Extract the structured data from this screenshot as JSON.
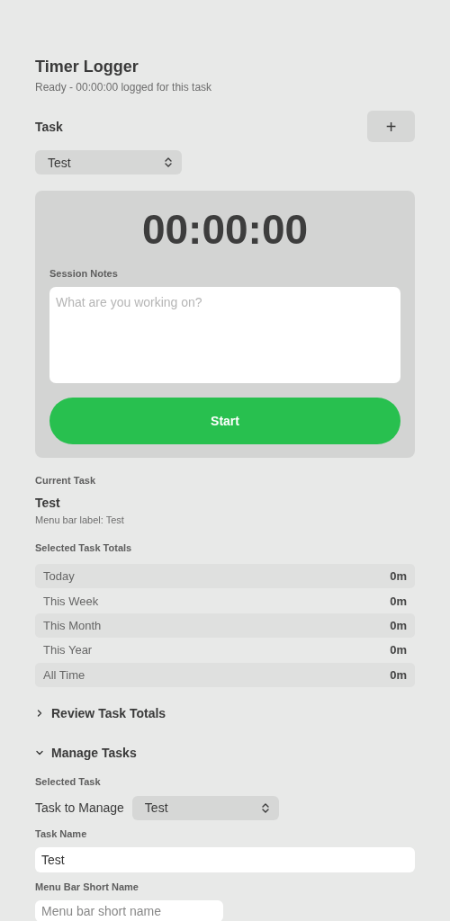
{
  "app": {
    "title": "Timer Logger",
    "status": "Ready - 00:00:00 logged for this task"
  },
  "task_picker": {
    "label": "Task",
    "add_button": "+",
    "value": "Test"
  },
  "timer": {
    "display": "00:00:00",
    "notes_label": "Session Notes",
    "notes_placeholder": "What are you working on?",
    "start_button": "Start"
  },
  "current_task": {
    "heading": "Current Task",
    "name": "Test",
    "menu_bar_label": "Menu bar label: Test"
  },
  "totals": {
    "heading": "Selected Task Totals",
    "rows": [
      {
        "period": "Today",
        "value": "0m"
      },
      {
        "period": "This Week",
        "value": "0m"
      },
      {
        "period": "This Month",
        "value": "0m"
      },
      {
        "period": "This Year",
        "value": "0m"
      },
      {
        "period": "All Time",
        "value": "0m"
      }
    ]
  },
  "sections": [
    {
      "kind": "review",
      "title": "Review Task Totals",
      "expanded": false
    },
    {
      "kind": "manage",
      "title": "Manage Tasks",
      "expanded": true
    }
  ],
  "manage": {
    "heading": "Selected Task",
    "task_to_manage_label": "Task to Manage",
    "task_to_manage_value": "Test",
    "task_name_label": "Task Name",
    "task_name_value": "Test",
    "short_name_label": "Menu Bar Short Name",
    "short_name_placeholder": "Menu bar short name"
  }
}
